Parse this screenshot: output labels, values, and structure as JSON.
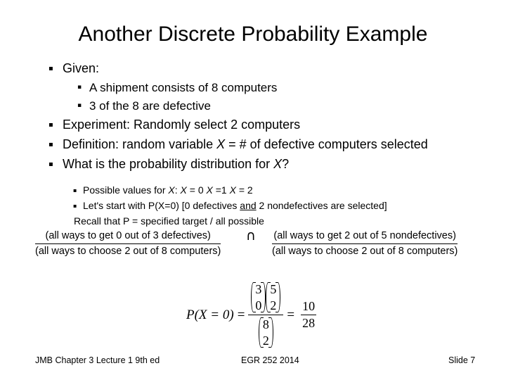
{
  "slide": {
    "title": "Another Discrete Probability Example",
    "bullet_glyph": "▪",
    "intersection_symbol": "∩"
  },
  "body": {
    "items": [
      {
        "level": 1,
        "text": "Given:"
      },
      {
        "level": 2,
        "text": "A shipment consists of 8 computers"
      },
      {
        "level": 2,
        "text": "3 of the 8 are defective"
      },
      {
        "level": 1,
        "text": "Experiment:   Randomly select 2 computers"
      },
      {
        "level": 1,
        "text": "Definition:  random variable "
      },
      {
        "level": 1,
        "text": "What is the probability distribution for "
      }
    ],
    "definition_line": {
      "prefix": "Definition:  random variable ",
      "variable": "X",
      "suffix": " = # of defective computers selected"
    },
    "question_line": {
      "prefix": "What is the probability distribution for ",
      "variable": "X",
      "suffix": "?"
    }
  },
  "subitems": {
    "possible_values": {
      "prefix": "Possible  values for ",
      "var1": "X",
      "sep1": ":   ",
      "var2": "X",
      "val2": " = 0   ",
      "var3": "X",
      "val3": " =1   ",
      "var4": "X",
      "val4": " = 2"
    },
    "start_line": {
      "prefix": "Let's start with P(X=0)    [0 defectives ",
      "underlined": "and",
      "suffix": "  2 nondefectives are selected]"
    },
    "recall_line": "Recall that P = specified target / all possible"
  },
  "ratios": {
    "left": {
      "numerator": "(all ways to get 0 out of 3 defectives)",
      "denominator": "(all ways to choose 2 out of 8 computers)"
    },
    "right": {
      "numerator": "(all ways to get 2 out of 5 nondefectives)",
      "denominator": "(all ways to choose 2 out of 8 computers)"
    }
  },
  "equation": {
    "lhs": "P(X = 0)",
    "equals": "=",
    "binom1_top": "3",
    "binom1_bot": "0",
    "binom2_top": "5",
    "binom2_bot": "2",
    "binom3_top": "8",
    "binom3_bot": "2",
    "equals2": "=",
    "result_num": "10",
    "result_den": "28"
  },
  "footer": {
    "left": "JMB Chapter 3 Lecture 1 9th ed",
    "middle": "EGR 252 2014",
    "right": "Slide  7"
  }
}
